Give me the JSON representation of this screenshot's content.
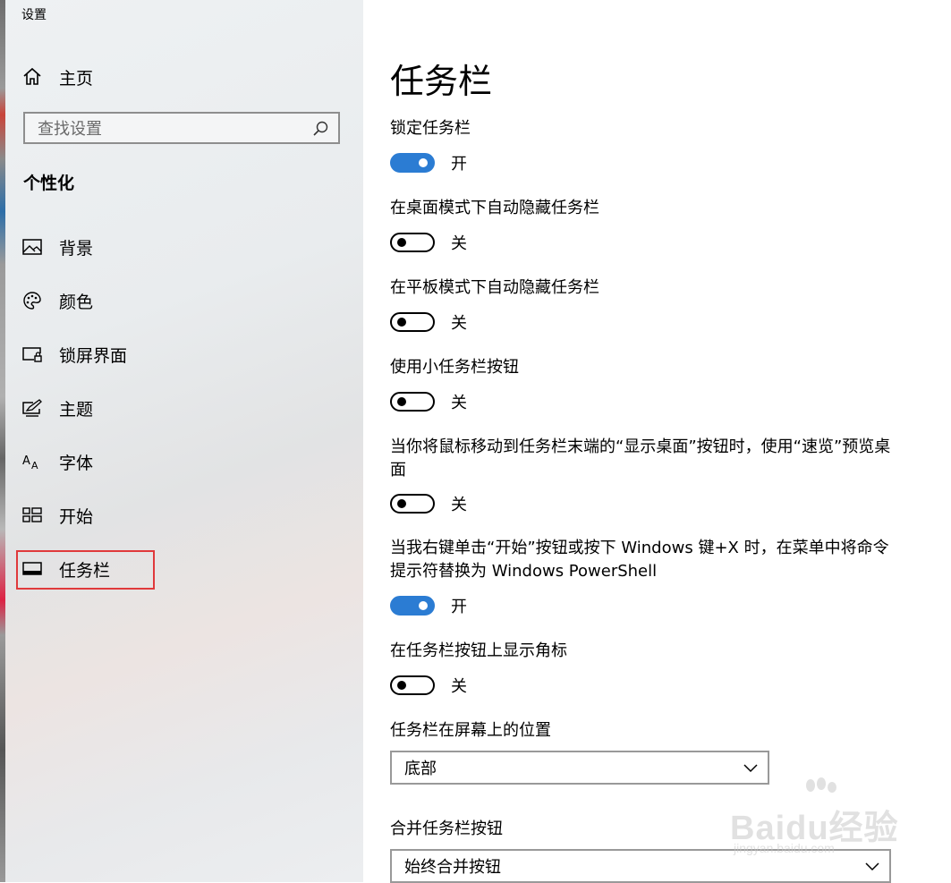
{
  "window": {
    "title": "设置"
  },
  "sidebar": {
    "home_label": "主页",
    "search_placeholder": "查找设置",
    "section_title": "个性化",
    "items": [
      {
        "label": "背景",
        "icon": "picture-icon"
      },
      {
        "label": "颜色",
        "icon": "palette-icon"
      },
      {
        "label": "锁屏界面",
        "icon": "lock-screen-icon"
      },
      {
        "label": "主题",
        "icon": "theme-icon"
      },
      {
        "label": "字体",
        "icon": "font-icon"
      },
      {
        "label": "开始",
        "icon": "start-icon"
      },
      {
        "label": "任务栏",
        "icon": "taskbar-icon",
        "selected": true
      }
    ]
  },
  "main": {
    "title": "任务栏",
    "settings": [
      {
        "label": "锁定任务栏",
        "state": "开",
        "on": true
      },
      {
        "label": "在桌面模式下自动隐藏任务栏",
        "state": "关",
        "on": false
      },
      {
        "label": "在平板模式下自动隐藏任务栏",
        "state": "关",
        "on": false
      },
      {
        "label": "使用小任务栏按钮",
        "state": "关",
        "on": false
      },
      {
        "label": "当你将鼠标移动到任务栏末端的“显示桌面”按钮时，使用“速览”预览桌面",
        "state": "关",
        "on": false
      },
      {
        "label": "当我右键单击“开始”按钮或按下 Windows 键+X 时，在菜单中将命令提示符替换为 Windows PowerShell",
        "state": "开",
        "on": true
      },
      {
        "label": "在任务栏按钮上显示角标",
        "state": "关",
        "on": false
      }
    ],
    "position_label": "任务栏在屏幕上的位置",
    "position_value": "底部",
    "combine_label": "合并任务栏按钮",
    "combine_value": "始终合并按钮"
  },
  "colors": {
    "accent": "#2b7cd3",
    "highlight_box": "#e0393b"
  },
  "watermark": {
    "text": "Baidu经验",
    "sub": "jingyan.baidu.com"
  }
}
